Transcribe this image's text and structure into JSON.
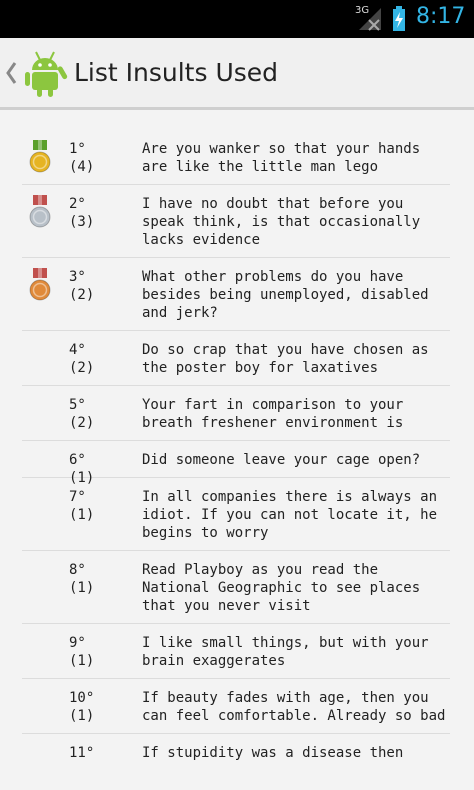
{
  "status_bar": {
    "network": "3G",
    "time": "8:17"
  },
  "action_bar": {
    "title": "List Insults Used"
  },
  "items": [
    {
      "rank": "1°",
      "count": "(4)",
      "text": "Are you wanker so that your hands are like the little man lego",
      "medal": "gold"
    },
    {
      "rank": "2°",
      "count": "(3)",
      "text": "I have no doubt that before you speak think, is that occasionally lacks evidence",
      "medal": "silver"
    },
    {
      "rank": "3°",
      "count": "(2)",
      "text": "What other problems do you have besides being unemployed, disabled and jerk?",
      "medal": "bronze"
    },
    {
      "rank": "4°",
      "count": "(2)",
      "text": "Do so crap that you have chosen as the poster boy for laxatives",
      "medal": ""
    },
    {
      "rank": "5°",
      "count": "(2)",
      "text": "Your fart in comparison to your breath freshener environment is",
      "medal": ""
    },
    {
      "rank": "6°",
      "count": "(1)",
      "text": "Did someone leave your cage open?",
      "medal": ""
    },
    {
      "rank": "7°",
      "count": "(1)",
      "text": "In all companies there is always an idiot. If you can not locate it, he begins to worry",
      "medal": ""
    },
    {
      "rank": "8°",
      "count": "(1)",
      "text": "Read Playboy as you read the National Geographic to see places that you never visit",
      "medal": ""
    },
    {
      "rank": "9°",
      "count": "(1)",
      "text": "I like small things, but with your brain exaggerates",
      "medal": ""
    },
    {
      "rank": "10°",
      "count": "(1)",
      "text": "If beauty fades with age, then you can feel comfortable. Already so bad",
      "medal": ""
    },
    {
      "rank": "11°",
      "count": "",
      "text": "If stupidity was a disease then",
      "medal": ""
    }
  ],
  "colors": {
    "gold": "#e6b422",
    "silver": "#b8c0c8",
    "bronze": "#e08a3a",
    "ribbon_gold": "#5aa02c",
    "ribbon_silver": "#c0504d",
    "ribbon_bronze": "#c0504d",
    "accent": "#33b5e5",
    "android_green": "#8cc63f"
  }
}
